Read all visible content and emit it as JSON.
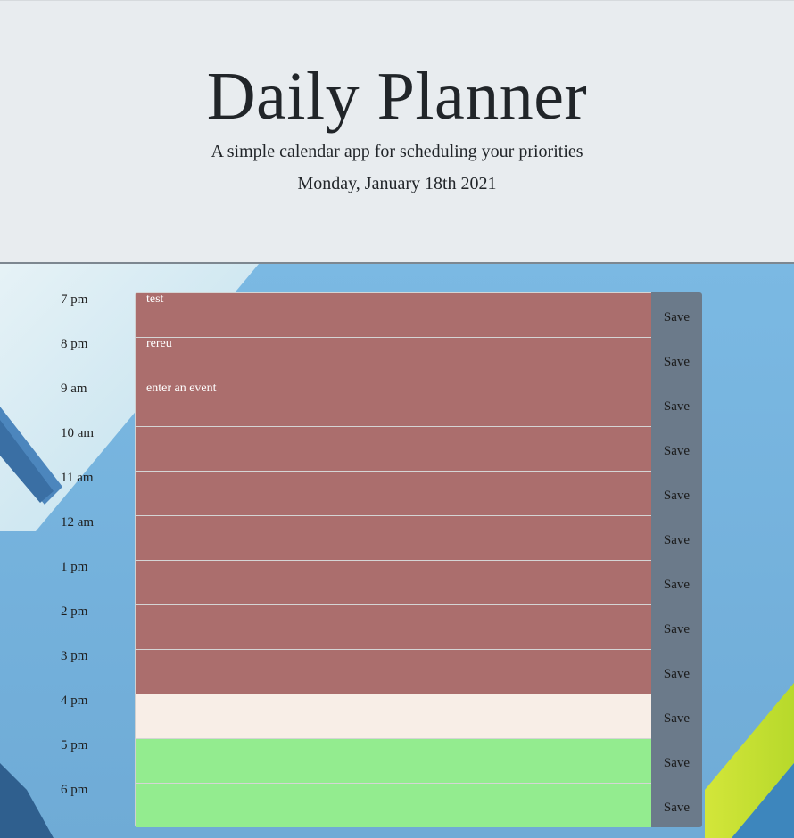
{
  "header": {
    "title": "Daily Planner",
    "subtitle": "A simple calendar app for scheduling your priorities",
    "current_day": "Monday, January 18th 2021"
  },
  "colors": {
    "past": "#ab6e6d",
    "present": "#f8eee7",
    "future": "#93ec8f",
    "save_button": "#6b7a8a"
  },
  "time_blocks": [
    {
      "hour": "7 pm",
      "text": "test",
      "status": "past",
      "save_label": "Save"
    },
    {
      "hour": "8 pm",
      "text": "rereu",
      "status": "past",
      "save_label": "Save"
    },
    {
      "hour": "9 am",
      "text": "enter an event",
      "status": "past",
      "save_label": "Save"
    },
    {
      "hour": "10 am",
      "text": "",
      "status": "past",
      "save_label": "Save"
    },
    {
      "hour": "11 am",
      "text": "",
      "status": "past",
      "save_label": "Save"
    },
    {
      "hour": "12 am",
      "text": "",
      "status": "past",
      "save_label": "Save"
    },
    {
      "hour": "1 pm",
      "text": "",
      "status": "past",
      "save_label": "Save"
    },
    {
      "hour": "2 pm",
      "text": "",
      "status": "past",
      "save_label": "Save"
    },
    {
      "hour": "3 pm",
      "text": "",
      "status": "past",
      "save_label": "Save"
    },
    {
      "hour": "4 pm",
      "text": "",
      "status": "present",
      "save_label": "Save"
    },
    {
      "hour": "5 pm",
      "text": "",
      "status": "future",
      "save_label": "Save"
    },
    {
      "hour": "6 pm",
      "text": "",
      "status": "future",
      "save_label": "Save"
    }
  ]
}
